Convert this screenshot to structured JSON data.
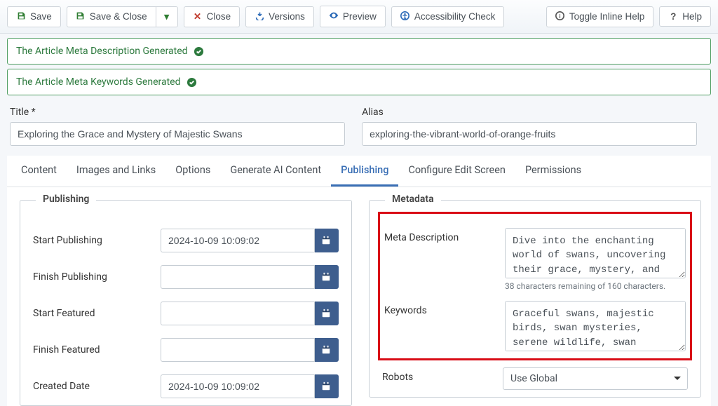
{
  "toolbar": {
    "save": "Save",
    "save_close": "Save & Close",
    "close": "Close",
    "versions": "Versions",
    "preview": "Preview",
    "accessibility": "Accessibility Check",
    "toggle_help": "Toggle Inline Help",
    "help": "Help"
  },
  "alerts": {
    "meta_desc": "The Article Meta Description Generated",
    "meta_keywords": "The Article Meta Keywords Generated"
  },
  "title": {
    "label": "Title *",
    "value": "Exploring the Grace and Mystery of Majestic Swans"
  },
  "alias": {
    "label": "Alias",
    "value": "exploring-the-vibrant-world-of-orange-fruits"
  },
  "tabs": [
    {
      "label": "Content"
    },
    {
      "label": "Images and Links"
    },
    {
      "label": "Options"
    },
    {
      "label": "Generate AI Content"
    },
    {
      "label": "Publishing"
    },
    {
      "label": "Configure Edit Screen"
    },
    {
      "label": "Permissions"
    }
  ],
  "publishing": {
    "legend": "Publishing",
    "start_publishing": {
      "label": "Start Publishing",
      "value": "2024-10-09 10:09:02"
    },
    "finish_publishing": {
      "label": "Finish Publishing",
      "value": ""
    },
    "start_featured": {
      "label": "Start Featured",
      "value": ""
    },
    "finish_featured": {
      "label": "Finish Featured",
      "value": ""
    },
    "created_date": {
      "label": "Created Date",
      "value": "2024-10-09 10:09:02"
    }
  },
  "metadata": {
    "legend": "Metadata",
    "meta_description": {
      "label": "Meta Description",
      "value": "Dive into the enchanting world of swans, uncovering their grace, mystery, and the fascinating roles they play in nature and folklore.",
      "hint": "38 characters remaining of 160 characters."
    },
    "keywords": {
      "label": "Keywords",
      "value": "Graceful swans, majestic birds, swan mysteries, serene wildlife, swan beauty, elegant swans, bird symbolism, swan habitats, river"
    },
    "robots": {
      "label": "Robots",
      "value": "Use Global"
    }
  }
}
